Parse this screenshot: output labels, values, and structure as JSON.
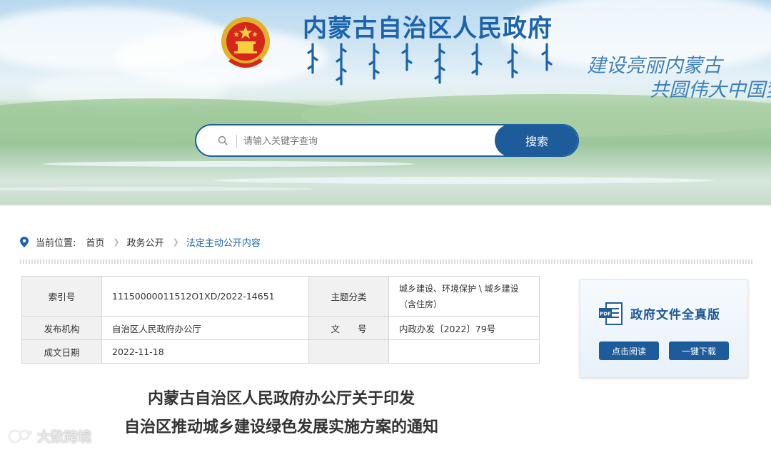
{
  "header": {
    "site_title": "内蒙古自治区人民政府",
    "slogan_line1": "建设亮丽内蒙古",
    "slogan_line2": "共圆伟大中国梦"
  },
  "search": {
    "placeholder": "请输入关键字查询",
    "button_label": "搜索"
  },
  "breadcrumb": {
    "label": "当前位置:",
    "items": [
      "首页",
      "政务公开",
      "法定主动公开内容"
    ]
  },
  "meta_table": {
    "index_label": "索引号",
    "index_value": "11150000011512O1XD/2022-14651",
    "topic_label": "主题分类",
    "topic_value": "城乡建设、环境保护 \\ 城乡建设（含住房）",
    "issuer_label": "发布机构",
    "issuer_value": "自治区人民政府办公厅",
    "docno_label": "文　　号",
    "docno_value": "内政办发〔2022〕79号",
    "date_label": "成文日期",
    "date_value": "2022-11-18"
  },
  "fulltext_card": {
    "title": "政府文件全真版",
    "read_button": "点击阅读",
    "download_button": "一键下载"
  },
  "document": {
    "title_line1": "内蒙古自治区人民政府办公厅关于印发",
    "title_line2": "自治区推动城乡建设绿色发展实施方案的通知"
  },
  "watermark": {
    "text": "大数跨境"
  },
  "colors": {
    "primary": "#1d5b9b",
    "title_blue": "#1b64ad"
  }
}
